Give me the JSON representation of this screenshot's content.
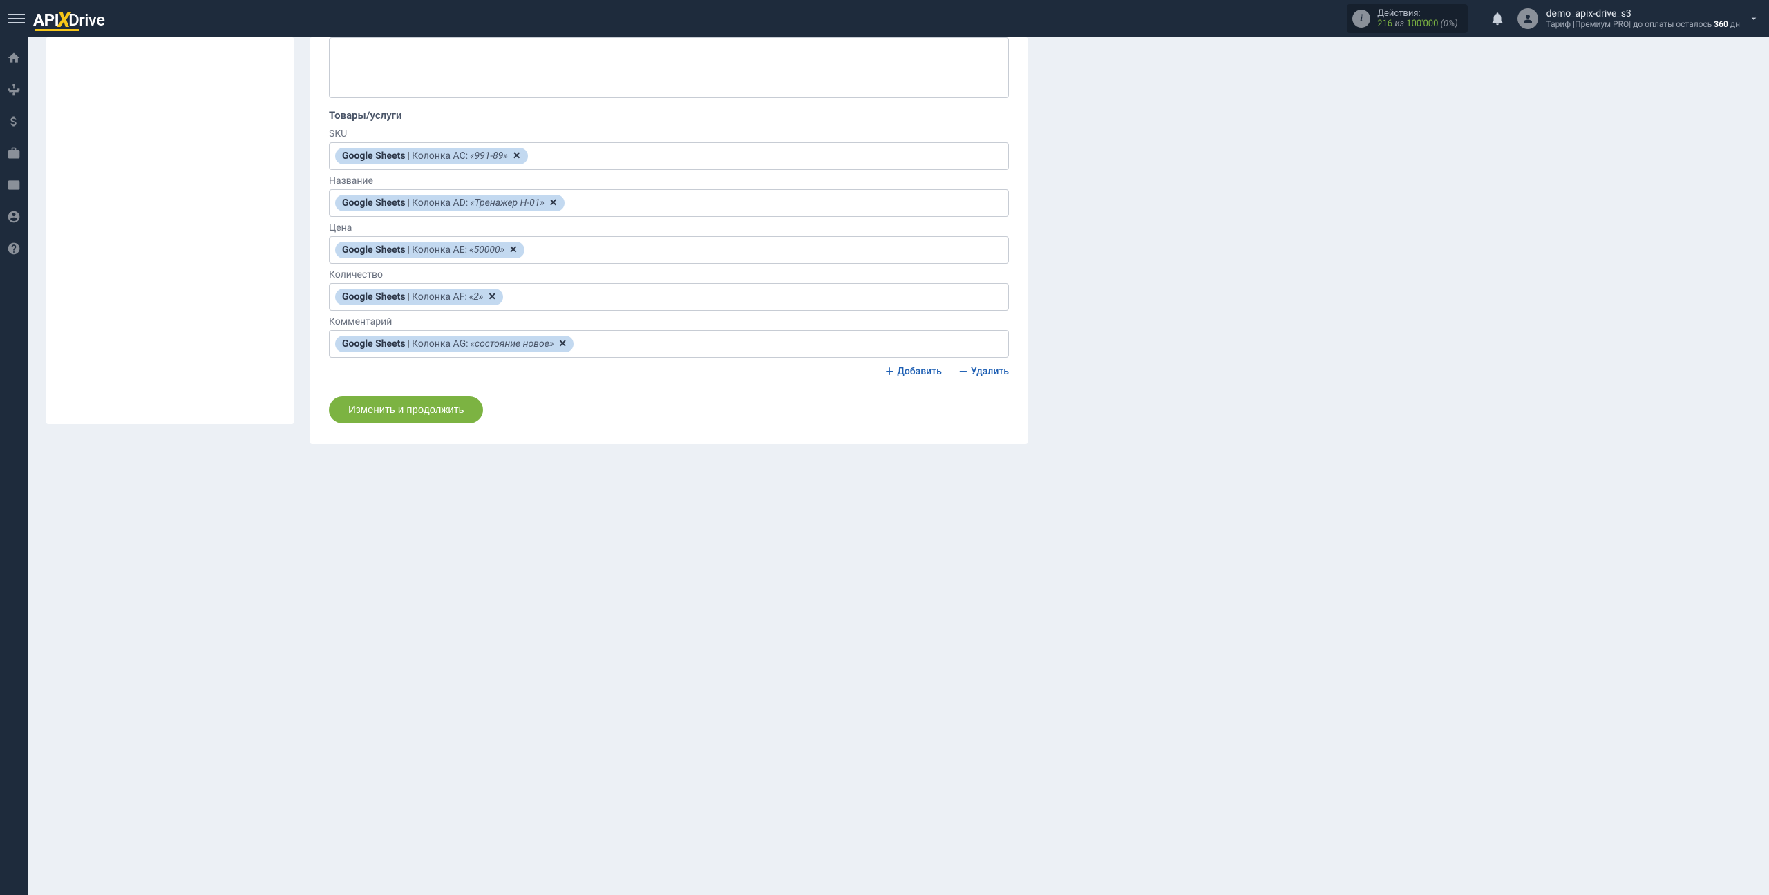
{
  "header": {
    "logo": {
      "part1": "API",
      "part2": "X",
      "part3": "Drive"
    },
    "actions": {
      "label": "Действия:",
      "used": "216",
      "of": "из",
      "limit": "100'000",
      "pct": "(0%)"
    },
    "user": {
      "name": "demo_apix-drive_s3",
      "tariff_prefix": "Тариф |",
      "tariff_plan": "Премиум PRO",
      "tariff_mid": "|  до оплаты осталось ",
      "days": "360",
      "days_suffix": " дн"
    }
  },
  "form": {
    "section_title": "Товары/услуги",
    "fields": [
      {
        "label": "SKU",
        "tag_source": "Google Sheets",
        "tag_column": "Колонка AC:",
        "tag_value": "«991-89»"
      },
      {
        "label": "Название",
        "tag_source": "Google Sheets",
        "tag_column": "Колонка AD:",
        "tag_value": "«Тренажер Н-01»"
      },
      {
        "label": "Цена",
        "tag_source": "Google Sheets",
        "tag_column": "Колонка AE:",
        "tag_value": "«50000»"
      },
      {
        "label": "Количество",
        "tag_source": "Google Sheets",
        "tag_column": "Колонка AF:",
        "tag_value": "«2»"
      },
      {
        "label": "Комментарий",
        "tag_source": "Google Sheets",
        "tag_column": "Колонка AG:",
        "tag_value": "«состояние новое»"
      }
    ],
    "links": {
      "add": "Добавить",
      "delete": "Удалить"
    },
    "submit": "Изменить и продолжить"
  }
}
